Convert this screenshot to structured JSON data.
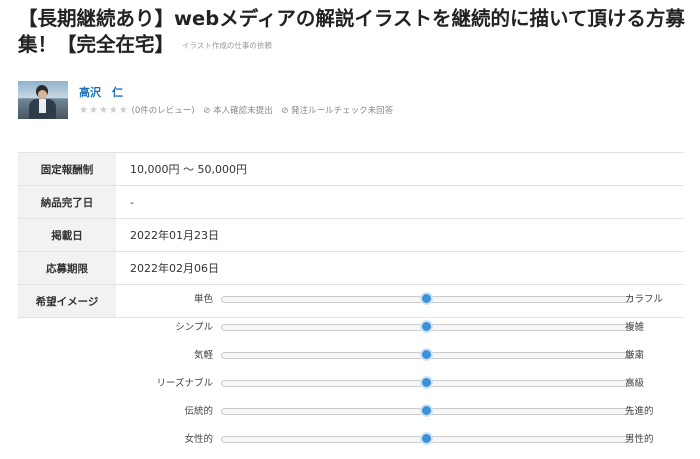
{
  "job": {
    "title": "【長期継続あり】webメディアの解説イラストを継続的に描いて頂ける方募集！【完全在宅】",
    "category": "イラスト作成の仕事の依頼"
  },
  "client": {
    "name": "高沢　仁",
    "stars": "★★★★★",
    "reviews": "(0件のレビュー)",
    "identity": "本人確認未提出",
    "rules": "発注ルールチェック未回答"
  },
  "info": {
    "rows": [
      {
        "label": "固定報酬制",
        "value": "10,000円 ～ 50,000円"
      },
      {
        "label": "納品完了日",
        "value": "-"
      },
      {
        "label": "掲載日",
        "value": "2022年01月23日"
      },
      {
        "label": "応募期限",
        "value": "2022年02月06日"
      }
    ],
    "image_label": "希望イメージ"
  },
  "image_sliders": [
    {
      "left": "単色",
      "right": "カラフル",
      "value": 0.5
    },
    {
      "left": "シンプル",
      "right": "複雑",
      "value": 0.5
    },
    {
      "left": "気軽",
      "right": "厳粛",
      "value": 0.5
    },
    {
      "left": "リーズナブル",
      "right": "高級",
      "value": 0.5
    },
    {
      "left": "伝統的",
      "right": "先進的",
      "value": 0.5
    },
    {
      "left": "女性的",
      "right": "男性的",
      "value": 0.5
    }
  ],
  "colors": {
    "accent": "#3d8fd9",
    "link": "#1a73b8",
    "header_bg": "#f2f2f2"
  }
}
